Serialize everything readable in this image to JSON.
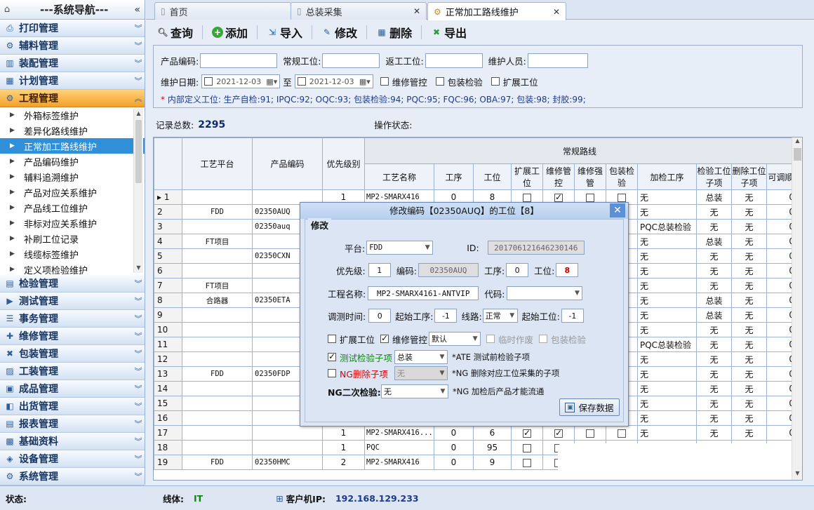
{
  "nav": {
    "title": "---系统导航---",
    "collapse_icon": "«",
    "modules_top": [
      {
        "label": "打印管理",
        "icon": "printer-icon"
      },
      {
        "label": "辅料管理",
        "icon": "gear-icon"
      },
      {
        "label": "装配管理",
        "icon": "assembly-icon"
      },
      {
        "label": "计划管理",
        "icon": "calendar-icon"
      },
      {
        "label": "工程管理",
        "icon": "gear-icon"
      }
    ],
    "sub_items": [
      "外箱标签维护",
      "差异化路线维护",
      "正常加工路线维护",
      "产品编码维护",
      "辅料追溯维护",
      "产品对应关系维护",
      "产品线工位维护",
      "非标对应关系维护",
      "补刷工位记录",
      "线缆标签维护",
      "定义项检验维护"
    ],
    "modules_bottom": [
      {
        "label": "检验管理",
        "icon": "inspect-icon"
      },
      {
        "label": "测试管理",
        "icon": "test-icon"
      },
      {
        "label": "事务管理",
        "icon": "task-icon"
      },
      {
        "label": "维修管理",
        "icon": "repair-icon"
      },
      {
        "label": "包装管理",
        "icon": "package-icon"
      },
      {
        "label": "工装管理",
        "icon": "tool-icon"
      },
      {
        "label": "成品管理",
        "icon": "product-icon"
      },
      {
        "label": "出货管理",
        "icon": "shipping-icon"
      },
      {
        "label": "报表管理",
        "icon": "report-icon"
      },
      {
        "label": "基础资料",
        "icon": "database-icon"
      },
      {
        "label": "设备管理",
        "icon": "device-icon"
      },
      {
        "label": "系统管理",
        "icon": "system-icon"
      }
    ]
  },
  "tabs": [
    {
      "label": "首页"
    },
    {
      "label": "总装采集"
    },
    {
      "label": "正常加工路线维护"
    }
  ],
  "toolbar": {
    "query": "查询",
    "add": "添加",
    "import": "导入",
    "edit": "修改",
    "delete": "删除",
    "export": "导出"
  },
  "filter": {
    "product_code": "产品编码:",
    "normal_station": "常规工位:",
    "rework_station": "返工工位:",
    "maintainer": "维护人员:",
    "date_label": "维护日期:",
    "date_from": "2021-12-03",
    "to": "至",
    "date_to": "2021-12-03",
    "repair_ctrl": "维修管控",
    "pack_check": "包装检验",
    "ext_station": "扩展工位",
    "note": "内部定义工位: 生产自检:91; IPQC:92; OQC:93; 包装检验:94; PQC:95; FQC:96; OBA:97; 包装:98; 封胶:99;"
  },
  "summary": {
    "count_label": "记录总数:",
    "count": "2295",
    "op_label": "操作状态:"
  },
  "grid": {
    "group_header": "常规路线",
    "headers": [
      "工艺平台",
      "产品编码",
      "优先级别",
      "工艺名称",
      "工序",
      "工位",
      "扩展工位",
      "维修管控",
      "维修强管",
      "包装检验",
      "加检工序",
      "检验工位子项",
      "删除工位子项",
      "可调顺"
    ],
    "rows": [
      {
        "n": "1",
        "platform": "",
        "code": "",
        "pri": "1",
        "name": "MP2-SMARX416",
        "op": "0",
        "st": "8",
        "c1": false,
        "c2": true,
        "c3": false,
        "c4": false,
        "add": "无",
        "chk": "总装",
        "del": "无",
        "adj": "0"
      },
      {
        "n": "2",
        "platform": "FDD",
        "code": "02350AUQ",
        "pri": "",
        "name": "",
        "op": "",
        "st": "",
        "c1": false,
        "c2": false,
        "c3": false,
        "c4": false,
        "add": "无",
        "chk": "无",
        "del": "无",
        "adj": "0"
      },
      {
        "n": "3",
        "platform": "",
        "code": "02350auq",
        "pri": "",
        "name": "",
        "op": "",
        "st": "",
        "c1": false,
        "c2": false,
        "c3": false,
        "c4": false,
        "add": "PQC总装检验",
        "chk": "无",
        "del": "无",
        "adj": "0"
      },
      {
        "n": "4",
        "platform": "FT项目",
        "code": "",
        "pri": "",
        "name": "",
        "op": "",
        "st": "",
        "c1": false,
        "c2": false,
        "c3": false,
        "c4": false,
        "add": "无",
        "chk": "总装",
        "del": "无",
        "adj": "0"
      },
      {
        "n": "5",
        "platform": "",
        "code": "02350CXN",
        "pri": "",
        "name": "",
        "op": "",
        "st": "",
        "c1": false,
        "c2": false,
        "c3": false,
        "c4": false,
        "add": "无",
        "chk": "无",
        "del": "无",
        "adj": "0"
      },
      {
        "n": "6",
        "platform": "",
        "code": "",
        "pri": "",
        "name": "",
        "op": "",
        "st": "",
        "c1": false,
        "c2": false,
        "c3": false,
        "c4": false,
        "add": "无",
        "chk": "无",
        "del": "无",
        "adj": "0"
      },
      {
        "n": "7",
        "platform": "FT项目",
        "code": "",
        "pri": "",
        "name": "",
        "op": "",
        "st": "",
        "c1": false,
        "c2": false,
        "c3": false,
        "c4": false,
        "add": "无",
        "chk": "无",
        "del": "无",
        "adj": "0"
      },
      {
        "n": "8",
        "platform": "合路器",
        "code": "02350ETA",
        "pri": "",
        "name": "",
        "op": "",
        "st": "",
        "c1": false,
        "c2": false,
        "c3": false,
        "c4": false,
        "add": "无",
        "chk": "总装",
        "del": "无",
        "adj": "0"
      },
      {
        "n": "9",
        "platform": "",
        "code": "",
        "pri": "",
        "name": "",
        "op": "",
        "st": "",
        "c1": false,
        "c2": false,
        "c3": false,
        "c4": false,
        "add": "无",
        "chk": "总装",
        "del": "无",
        "adj": "0"
      },
      {
        "n": "10",
        "platform": "",
        "code": "",
        "pri": "",
        "name": "",
        "op": "",
        "st": "",
        "c1": false,
        "c2": false,
        "c3": false,
        "c4": false,
        "add": "无",
        "chk": "无",
        "del": "无",
        "adj": "0"
      },
      {
        "n": "11",
        "platform": "",
        "code": "",
        "pri": "",
        "name": "",
        "op": "",
        "st": "",
        "c1": false,
        "c2": false,
        "c3": false,
        "c4": false,
        "add": "PQC总装检验",
        "chk": "无",
        "del": "无",
        "adj": "0"
      },
      {
        "n": "12",
        "platform": "",
        "code": "",
        "pri": "",
        "name": "",
        "op": "",
        "st": "",
        "c1": false,
        "c2": false,
        "c3": false,
        "c4": false,
        "add": "无",
        "chk": "无",
        "del": "无",
        "adj": "0"
      },
      {
        "n": "13",
        "platform": "FDD",
        "code": "02350FDP",
        "pri": "",
        "name": "",
        "op": "",
        "st": "",
        "c1": false,
        "c2": false,
        "c3": false,
        "c4": false,
        "add": "无",
        "chk": "无",
        "del": "无",
        "adj": "0"
      },
      {
        "n": "14",
        "platform": "",
        "code": "",
        "pri": "",
        "name": "",
        "op": "",
        "st": "",
        "c1": false,
        "c2": false,
        "c3": false,
        "c4": false,
        "add": "无",
        "chk": "无",
        "del": "无",
        "adj": "0"
      },
      {
        "n": "15",
        "platform": "",
        "code": "",
        "pri": "",
        "name": "",
        "op": "",
        "st": "",
        "c1": false,
        "c2": false,
        "c3": false,
        "c4": false,
        "add": "无",
        "chk": "无",
        "del": "无",
        "adj": "0"
      },
      {
        "n": "16",
        "platform": "",
        "code": "",
        "pri": "",
        "name": "",
        "op": "",
        "st": "",
        "c1": false,
        "c2": false,
        "c3": false,
        "c4": false,
        "add": "无",
        "chk": "无",
        "del": "无",
        "adj": "0"
      },
      {
        "n": "17",
        "platform": "",
        "code": "",
        "pri": "1",
        "name": "MP2-SMARX416...",
        "op": "0",
        "st": "6",
        "c1": true,
        "c2": true,
        "c3": false,
        "c4": false,
        "add": "无",
        "chk": "无",
        "del": "无",
        "adj": "0"
      },
      {
        "n": "18",
        "platform": "",
        "code": "",
        "pri": "1",
        "name": "PQC",
        "op": "0",
        "st": "95",
        "c1": false,
        "c2": false,
        "c3": false,
        "c4": false,
        "add": "",
        "chk": "",
        "del": "",
        "adj": ""
      },
      {
        "n": "19",
        "platform": "FDD",
        "code": "02350HMC",
        "pri": "2",
        "name": "MP2-SMARX416",
        "op": "0",
        "st": "9",
        "c1": false,
        "c2": false,
        "c3": false,
        "c4": false,
        "add": "",
        "chk": "",
        "del": "",
        "adj": ""
      }
    ]
  },
  "modal": {
    "title": "修改编码【02350AUQ】的工位【8】",
    "group": "修改",
    "platform_label": "平台:",
    "platform": "FDD",
    "id_label": "ID:",
    "id": "201706121646230146",
    "priority_label": "优先级:",
    "priority": "1",
    "code_label": "编码:",
    "code": "02350AUQ",
    "op_label": "工序:",
    "op": "0",
    "station_label": "工位:",
    "station": "8",
    "name_label": "工程名称:",
    "name": "MP2-SMARX4161-ANTVIP",
    "daima_label": "代码:",
    "daima": "",
    "adjust_label": "调测时间:",
    "adjust": "0",
    "start_op_label": "起始工序:",
    "start_op": "-1",
    "line_label": "线路:",
    "line": "正常",
    "start_st_label": "起始工位:",
    "start_st": "-1",
    "ext_label": "扩展工位",
    "repair_label": "维修管控",
    "repair_val": "默认",
    "temp_label": "临时作废",
    "pack_label": "包装检验",
    "test_label": "测试检验子项",
    "test_val": "总装",
    "test_hint": "*ATE 测试前检验子项",
    "ng_label": "NG删除子项",
    "ng_val": "无",
    "ng_hint": "*NG 删除对应工位采集的子项",
    "ng2_label": "NG二次检验:",
    "ng2_val": "无",
    "ng2_hint": "*NG 加检后产品才能流通",
    "save": "保存数据"
  },
  "status": {
    "state_label": "状态:",
    "line_label": "线体:",
    "line": "IT",
    "ip_label": "客户机IP:",
    "ip": "192.168.129.233"
  }
}
